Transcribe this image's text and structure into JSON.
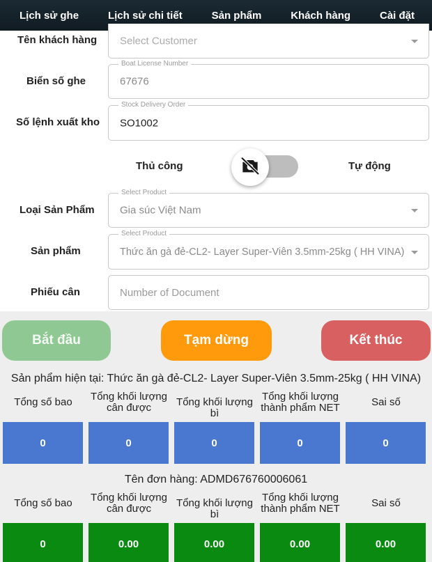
{
  "nav": {
    "items": [
      "Lịch sử ghe",
      "Lịch sử chi tiết",
      "Sản phẩm",
      "Khách hàng",
      "Cài đặt"
    ]
  },
  "form": {
    "customer": {
      "label": "Tên khách hàng",
      "placeholder": "Select Customer"
    },
    "boat_license": {
      "label": "Biển số ghe",
      "legend": "Boat License Number",
      "value": "67676"
    },
    "stock_order": {
      "label": "Số lệnh xuất kho",
      "legend": "Stock Delivery Order",
      "value": "SO1002"
    },
    "mode": {
      "manual_label": "Thủ công",
      "auto_label": "Tự động",
      "toggle_icon": "camera-off-icon"
    },
    "product_type": {
      "label": "Loại Sản Phẩm",
      "legend": "Select Product",
      "value": "Gia súc Việt Nam"
    },
    "product": {
      "label": "Sản phẩm",
      "legend": "Select Product",
      "value": "Thức ăn gà đẻ-CL2- Layer Super-Viên 3.5mm-25kg ( HH VINA)"
    },
    "weigh_ticket": {
      "label": "Phiếu cân",
      "placeholder": "Number of Document"
    }
  },
  "actions": {
    "start": "Bắt đầu",
    "pause": "Tạm dừng",
    "end": "Kết thúc"
  },
  "current": {
    "text": "Sản phẩm hiện tại:  Thức ăn gà đẻ-CL2- Layer Super-Viên 3.5mm-25kg ( HH VINA)",
    "headers": [
      [
        "Tổng số bao"
      ],
      [
        "Tổng khối lượng",
        "cân được"
      ],
      [
        "Tổng khối lượng bì"
      ],
      [
        "Tổng khối lượng",
        "thành phẩm NET"
      ],
      [
        "Sai số"
      ]
    ],
    "values": [
      "0",
      "0",
      "0",
      "0",
      "0"
    ]
  },
  "order": {
    "text": "Tên đơn hàng:  ADMD676760006061",
    "headers": [
      [
        "Tổng số bao"
      ],
      [
        "Tổng khối lượng",
        "cân được"
      ],
      [
        "Tổng khối lượng bì"
      ],
      [
        "Tổng khối lượng",
        "thành phẩm NET"
      ],
      [
        "Sai số"
      ]
    ],
    "values": [
      "0",
      "0.00",
      "0.00",
      "0.00",
      "0.00"
    ]
  },
  "colors": {
    "blue_box": "#4a77cf",
    "green_box": "#0b8a12",
    "start": "#90c894",
    "pause": "#ff9a0d",
    "end": "#d86060"
  }
}
